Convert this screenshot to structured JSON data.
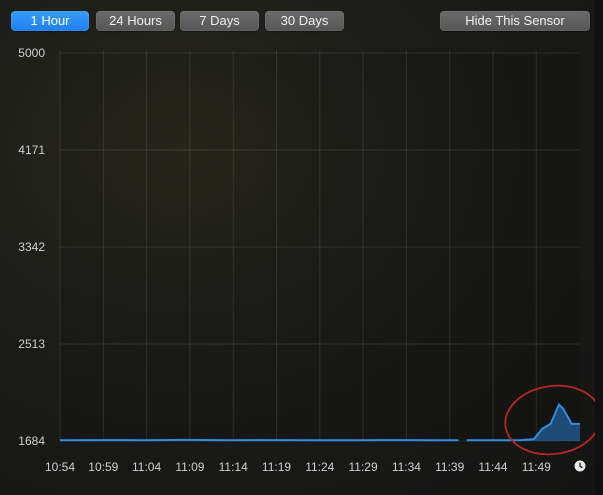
{
  "tabs": [
    {
      "label": "1 Hour",
      "active": true
    },
    {
      "label": "24 Hours",
      "active": false
    },
    {
      "label": "7 Days",
      "active": false
    },
    {
      "label": "30 Days",
      "active": false
    }
  ],
  "hide_button_label": "Hide This Sensor",
  "chart_data": {
    "type": "area",
    "title": "",
    "xlabel": "",
    "ylabel": "",
    "ylim": [
      1684,
      5000
    ],
    "y_ticks": [
      "5000",
      "4171",
      "3342",
      "2513",
      "1684"
    ],
    "x_ticks": [
      "10:54",
      "10:59",
      "11:04",
      "11:09",
      "11:14",
      "11:19",
      "11:24",
      "11:29",
      "11:34",
      "11:39",
      "11:44",
      "11:49"
    ],
    "grid": true,
    "series": [
      {
        "color": "#2f8ee0",
        "segments": [
          {
            "x": [
              0,
              5,
              10,
              15,
              20,
              25,
              30,
              35,
              40,
              45,
              47.5
            ],
            "y": [
              1690,
              1692,
              1691,
              1693,
              1691,
              1692,
              1690,
              1691,
              1692,
              1690,
              1691
            ]
          },
          {
            "x": [
              48.5,
              50,
              52,
              55,
              56.5,
              57.5,
              58.5,
              59.5,
              60,
              61,
              62
            ],
            "y": [
              1690,
              1691,
              1690,
              1692,
              1700,
              1790,
              1830,
              1995,
              1960,
              1830,
              1830
            ]
          }
        ]
      }
    ],
    "annotation": {
      "shape": "ellipse",
      "color": "#b8281e"
    },
    "clock_icon": "clock-icon"
  }
}
